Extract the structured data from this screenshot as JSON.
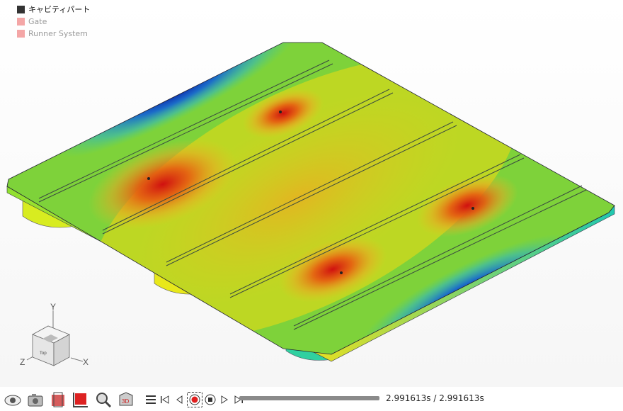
{
  "legend": {
    "items": [
      {
        "label": "キャビティパート",
        "color": "#333333",
        "text_color": "#111111"
      },
      {
        "label": "Gate",
        "color": "#f4a6a6",
        "text_color": "#9a9a9a"
      },
      {
        "label": "Runner System",
        "color": "#f4a6a6",
        "text_color": "#9a9a9a"
      }
    ]
  },
  "view_cube": {
    "face_label": "Top",
    "axis_x": "X",
    "axis_y": "Y",
    "axis_z": "Z"
  },
  "toolbar": {
    "icons": [
      "eye-icon",
      "camera-icon",
      "section-plane-icon",
      "clipping-box-icon",
      "magnifier-icon",
      "3d-view-icon"
    ]
  },
  "playback": {
    "current_time": "2.991613s",
    "separator": " / ",
    "total_time": "2.991613s",
    "progress": 1.0,
    "colors": {
      "record": "#e12020",
      "accent": "#333333"
    }
  }
}
